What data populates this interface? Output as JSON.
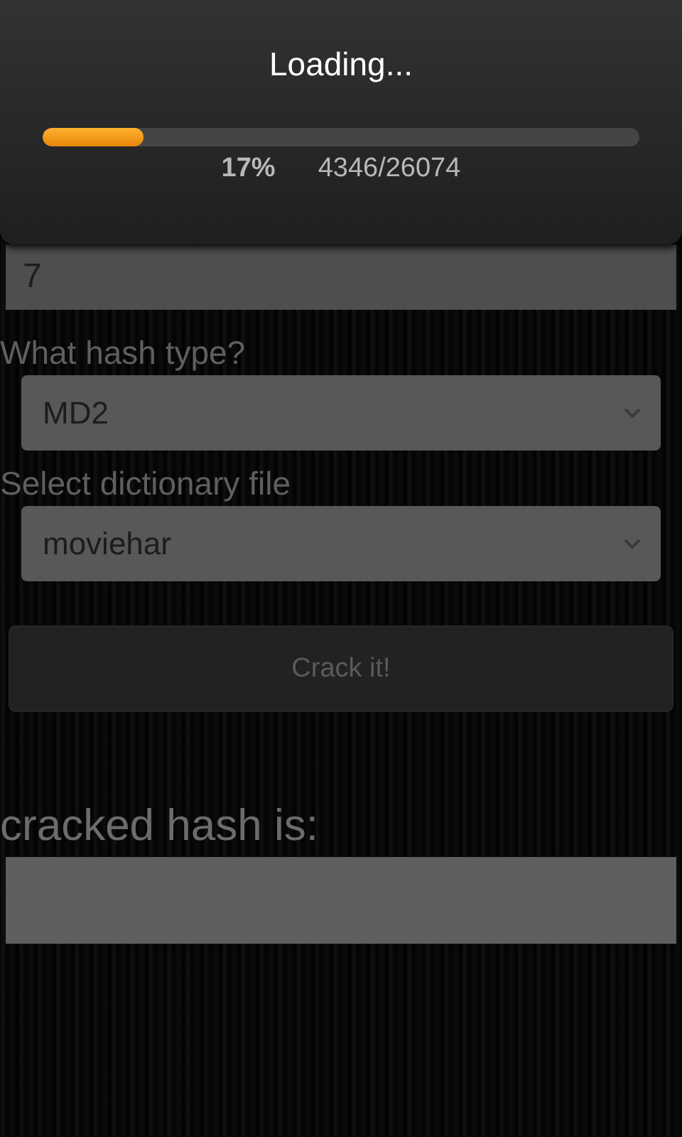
{
  "dialog": {
    "title": "Loading...",
    "level": 0.17,
    "percent": "17%",
    "count": "4346/26074"
  },
  "hash_field": {
    "value": "7"
  },
  "hash_type": {
    "label": "What hash type?",
    "value": "MD2"
  },
  "dictionary": {
    "label": "Select dictionary file",
    "value": "moviehar"
  },
  "crack_button": {
    "label": "Crack it!",
    "disabled": true
  },
  "result": {
    "label": "cracked hash is:"
  }
}
